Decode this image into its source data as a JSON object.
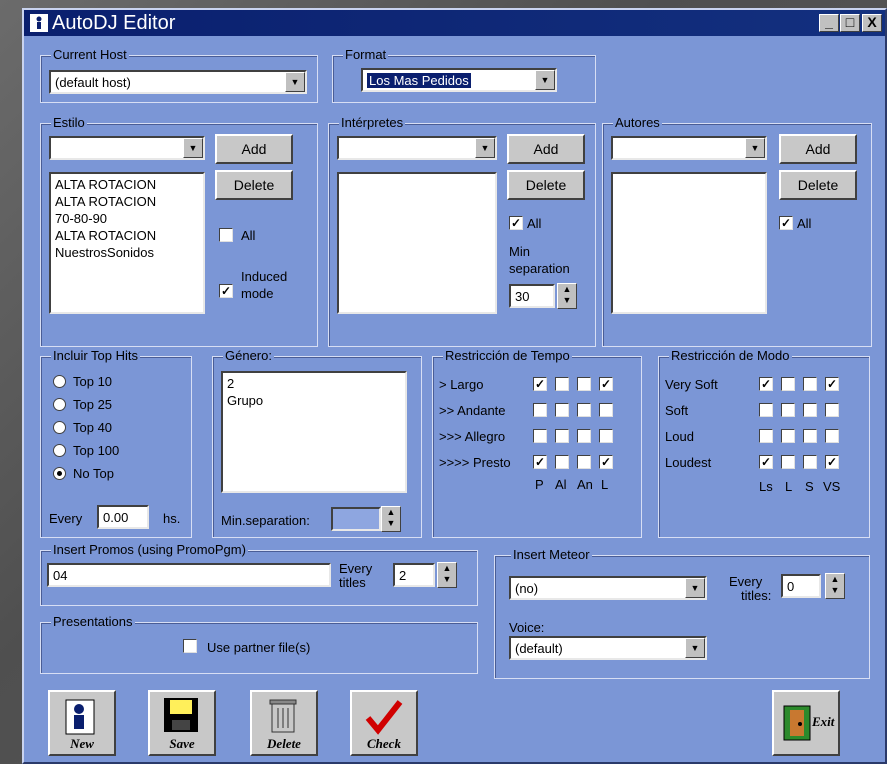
{
  "window": {
    "title": "AutoDJ Editor",
    "min": "_",
    "max": "□",
    "close": "X"
  },
  "host": {
    "legend": "Current Host",
    "value": "(default host)"
  },
  "format": {
    "legend": "Format",
    "value": "Los Mas Pedidos"
  },
  "estilo": {
    "legend": "Estilo",
    "add": "Add",
    "delete": "Delete",
    "all": "All",
    "induced1": "Induced",
    "induced2": "mode",
    "items": [
      "ALTA ROTACION",
      "ALTA ROTACION",
      "70-80-90",
      "ALTA ROTACION",
      "NuestrosSonidos"
    ]
  },
  "interpretes": {
    "legend": "Intérpretes",
    "add": "Add",
    "delete": "Delete",
    "all": "All",
    "minsep1": "Min",
    "minsep2": "separation",
    "minsep_value": "30"
  },
  "autores": {
    "legend": "Autores",
    "add": "Add",
    "delete": "Delete",
    "all": "All"
  },
  "tophits": {
    "legend": "Incluir Top Hits",
    "options": [
      "Top 10",
      "Top 25",
      "Top 40",
      "Top 100",
      "No Top"
    ],
    "selected": "No Top",
    "every": "Every",
    "every_value": "0.00",
    "hs": "hs."
  },
  "genero": {
    "legend": "Género:",
    "items": [
      "2",
      "Grupo"
    ],
    "minsep": "Min.separation:"
  },
  "tempo": {
    "legend": "Restricción de Tempo",
    "rows": [
      "> Largo",
      ">> Andante",
      ">>> Allegro",
      ">>>> Presto"
    ],
    "cols": [
      "P",
      "Al",
      "An",
      "L"
    ]
  },
  "modo": {
    "legend": "Restricción de Modo",
    "rows": [
      "Very Soft",
      "Soft",
      "Loud",
      "Loudest"
    ],
    "cols": [
      "Ls",
      "L",
      "S",
      "VS"
    ]
  },
  "promos": {
    "legend": "Insert Promos (using PromoPgm)",
    "value": "04",
    "every1": "Every",
    "every2": "titles",
    "every_value": "2"
  },
  "meteor": {
    "legend": "Insert Meteor",
    "value": "(no)",
    "voice": "Voice:",
    "voice_value": "(default)",
    "every1": "Every",
    "every2": "titles:",
    "every_value": "0"
  },
  "presentations": {
    "legend": "Presentations",
    "use": "Use partner file(s)"
  },
  "toolbar": {
    "new": "New",
    "save": "Save",
    "delete": "Delete",
    "check": "Check",
    "exit": "Exit"
  }
}
